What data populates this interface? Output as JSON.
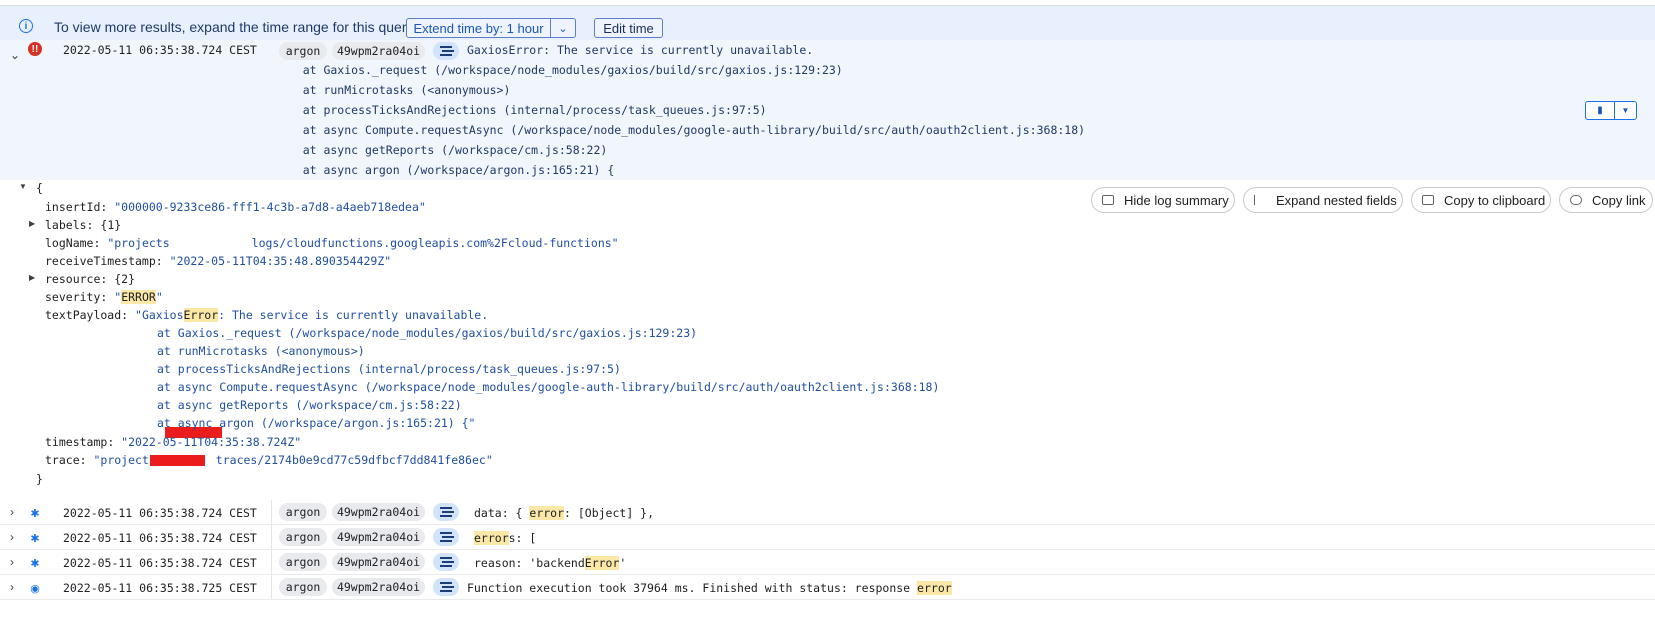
{
  "banner": {
    "message": "To view more results, expand the time range for this query.",
    "extend_label": "Extend time by: 1 hour",
    "edit_label": "Edit time"
  },
  "entry": {
    "timestamp": "2022-05-11 06:35:38.724 CEST",
    "chip_fn": "argon",
    "chip_exec": "49wpm2ra04oi",
    "lines": [
      "GaxiosError: The service is currently unavailable.",
      "    at Gaxios._request (/workspace/node_modules/gaxios/build/src/gaxios.js:129:23)",
      "    at runMicrotasks (<anonymous>)",
      "    at processTicksAndRejections (internal/process/task_queues.js:97:5)",
      "    at async Compute.requestAsync (/workspace/node_modules/google-auth-library/build/src/auth/oauth2client.js:368:18)",
      "    at async getReports (/workspace/cm.js:58:22)",
      "    at async argon (/workspace/argon.js:165:21) {"
    ]
  },
  "actions": {
    "hide_summary": "Hide log summary",
    "expand_nested": "Expand nested fields",
    "copy_clipboard": "Copy to clipboard",
    "copy_link": "Copy link"
  },
  "json": {
    "open": "{",
    "close": "}",
    "insertId_key": "insertId",
    "insertId_val": "\"000000-9233ce86-fff1-4c3b-a7d8-a4aeb718edea\"",
    "labels_key": "labels",
    "labels_val": "{1}",
    "logName_key": "logName",
    "logName_val_a": "\"projects",
    "logName_val_b": "logs/cloudfunctions.googleapis.com%2Fcloud-functions\"",
    "receive_key": "receiveTimestamp",
    "receive_val": "\"2022-05-11T04:35:48.890354429Z\"",
    "resource_key": "resource",
    "resource_val": "{2}",
    "severity_key": "severity",
    "severity_q1": "\"",
    "severity_val": "ERROR",
    "severity_q2": "\"",
    "payload_key": "textPayload",
    "payload_a": "\"Gaxios",
    "payload_hl": "Error",
    "payload_b": ": The service is currently unavailable.",
    "payload_lines": [
      "at Gaxios._request (/workspace/node_modules/gaxios/build/src/gaxios.js:129:23)",
      "at runMicrotasks (<anonymous>)",
      "at processTicksAndRejections (internal/process/task_queues.js:97:5)",
      "at async Compute.requestAsync (/workspace/node_modules/google-auth-library/build/src/auth/oauth2client.js:368:18)",
      "at async getReports (/workspace/cm.js:58:22)",
      "at async argon (/workspace/argon.js:165:21) {\""
    ],
    "timestamp_key": "timestamp",
    "timestamp_val": "\"2022-05-11T04:35:38.724Z\"",
    "trace_key": "trace",
    "trace_val_a": "\"projects",
    "trace_val_b": "traces/2174b0e9cd77c59dfbcf7dd841fe86ec\""
  },
  "rows": [
    {
      "timestamp": "2022-05-11 06:35:38.724 CEST",
      "fn": "argon",
      "exec": "49wpm2ra04oi",
      "pre": "data: { ",
      "hl": "error",
      "post": ": [Object] },"
    },
    {
      "timestamp": "2022-05-11 06:35:38.724 CEST",
      "fn": "argon",
      "exec": "49wpm2ra04oi",
      "pre": "",
      "hl": "error",
      "post": "s: ["
    },
    {
      "timestamp": "2022-05-11 06:35:38.724 CEST",
      "fn": "argon",
      "exec": "49wpm2ra04oi",
      "pre": "reason: 'backend",
      "hl": "Error",
      "post": "'"
    },
    {
      "timestamp": "2022-05-11 06:35:38.725 CEST",
      "fn": "argon",
      "exec": "49wpm2ra04oi",
      "pre": "Function execution took 37964 ms. Finished with status: response ",
      "hl": "error",
      "post": ""
    }
  ],
  "colors": {
    "accent": "#1a73e8",
    "error": "#d93025",
    "highlight": "#fce8a6",
    "selected_row": "#f1f5fc"
  }
}
